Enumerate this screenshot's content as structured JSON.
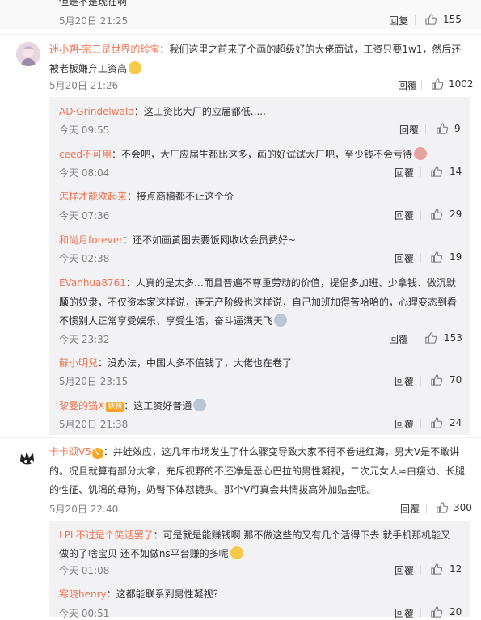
{
  "top": {
    "partial_text": "但是不是现在啊",
    "time": "5月20日 21:25",
    "reply": "回复",
    "likes": "155"
  },
  "comment1": {
    "user": "迷小朔-宗三是世界的珍宝",
    "text": "：我们这里之前来了个画的超级好的大佬面试，工资只要1w1，然后还被老板嫌弃工资高",
    "time": "5月20日 21:26",
    "reply": "回覆",
    "likes": "1002",
    "replies": [
      {
        "user": "AD·Grindelwald",
        "text": "：这工资比大厂的应届都低.....",
        "time": "今天 09:55",
        "reply": "回覆",
        "likes": "9"
      },
      {
        "user": "ceed不可用",
        "text": "：不会吧，大厂应届生都比这多，画的好试试大厂吧，至少钱不会亏待",
        "time": "今天 08:04",
        "reply": "回覆",
        "likes": "14"
      },
      {
        "user": "怎样才能欧起来",
        "text": "：接点商稿都不止这个价",
        "time": "今天 07:36",
        "reply": "回覆",
        "likes": "29"
      },
      {
        "user": "和尚月forever",
        "text": "：还不如画黄图去要饭网收收会员费好~",
        "time": "今天 02:38",
        "reply": "回覆",
        "likes": "19"
      },
      {
        "user": "EVanhua8761",
        "text_line1": "：人真的是太多…而且普遍不尊重劳动的价值，提倡多加班、少拿钱、做沉默顺",
        "text_line2": "从的奴隶，不仅资本家这样说，连无产阶级也这样说，自己加班加得苦哈哈的，心理变态到看",
        "text_line3": "不惯别人正常享受娱乐、享受生活，奋斗逼满天飞",
        "time": "今天 23:32",
        "reply": "回覆",
        "likes": "153"
      },
      {
        "user": "蘇小明兒",
        "text": "：没办法，中国人多不值钱了，大佬也在卷了",
        "time": "5月20日 23:15",
        "reply": "回覆",
        "likes": "70"
      },
      {
        "user": "黎曼的猫X",
        "badge": "铁粉",
        "text": "：这工资好普通",
        "time": "5月20日 21:38",
        "reply": "回覆",
        "likes": "24"
      }
    ]
  },
  "comment2": {
    "user": "卡卡颂V5",
    "text_line1": "：并蛙效应，这几年市场发生了什么骤变导致大家不得不卷进红海，男大V是不敢讲",
    "text_line2": "的。况且就算有部分大拿，充斥视野的不还净是恶心巴拉的男性凝视，二次元女人≈白瘦幼、长腿",
    "text_line3": "的性征、饥渴的母狗，奶臀下体怼镜头。那个V可真会共情拔高外加贴金呢。",
    "time": "5月20日 22:40",
    "reply": "回覆",
    "likes": "300",
    "replies": [
      {
        "user": "LPL不过是个笑话罢了",
        "text_line1": "：可是就是能赚钱啊 那不做这些的又有几个活得下去 就手机那机能又",
        "text_line2": "做的了啥宝贝 还不如做ns平台赚的多呢",
        "time": "今天 01:08",
        "reply": "回覆",
        "likes": "12"
      },
      {
        "user": "寒晓henry",
        "text": "：这都能联系到男性凝视？",
        "time": "今天 00:51",
        "reply": "回覆",
        "likes": "20"
      }
    ]
  }
}
